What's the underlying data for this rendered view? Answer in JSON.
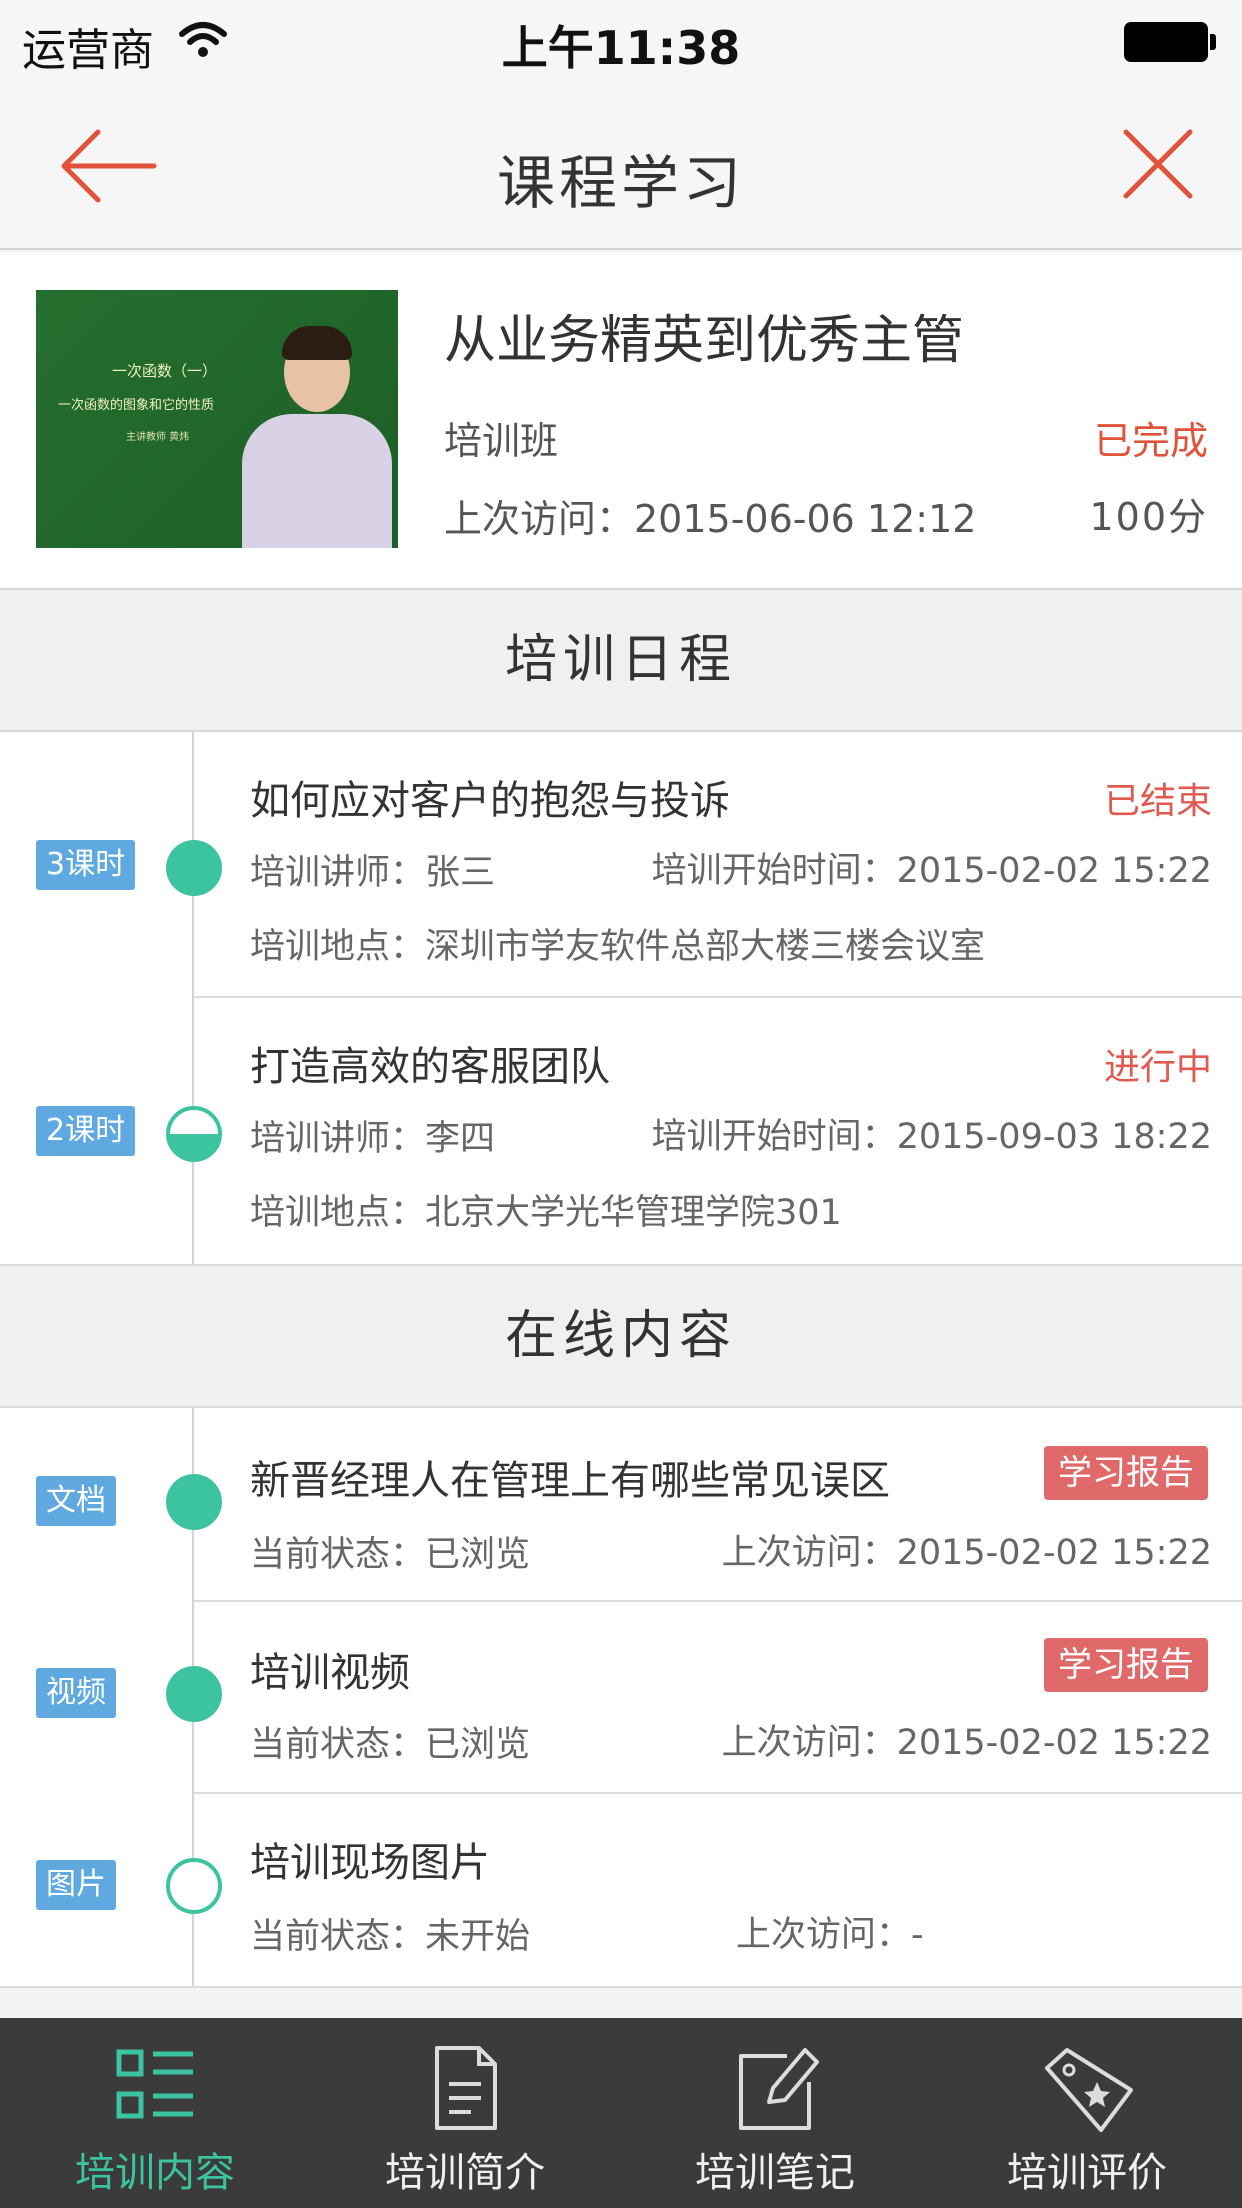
{
  "status_bar": {
    "carrier": "运营商",
    "time": "上午11:38"
  },
  "nav": {
    "title": "课程学习",
    "back_icon": "arrow-left-icon",
    "close_icon": "close-icon",
    "accent_color": "#e0533a"
  },
  "course": {
    "title": "从业务精英到优秀主管",
    "type": "培训班",
    "status": "已完成",
    "last_visit": "上次访问：2015-06-06 12:12",
    "score": "100分",
    "thumbnail": {
      "line1": "一次函数（一）",
      "line2": "一次函数的图象和它的性质",
      "line3": "主讲教师  黄炜"
    }
  },
  "schedule": {
    "header": "培训日程",
    "items": [
      {
        "tag": "3课时",
        "status_icon": "filled-dot",
        "title": "如何应对客户的抱怨与投诉",
        "state": "已结束",
        "lecturer": "培训讲师：张三",
        "start": "培训开始时间：2015-02-02 15:22",
        "location": "培训地点：深圳市学友软件总部大楼三楼会议室"
      },
      {
        "tag": "2课时",
        "status_icon": "half-filled-dot",
        "title": "打造高效的客服团队",
        "state": "进行中",
        "lecturer": "培训讲师：李四",
        "start": "培训开始时间：2015-09-03 18:22",
        "location": "培训地点：北京大学光华管理学院301"
      }
    ]
  },
  "online": {
    "header": "在线内容",
    "items": [
      {
        "tag": "文档",
        "status_icon": "filled-dot",
        "title": "新晋经理人在管理上有哪些常见误区",
        "badge": "学习报告",
        "state": "当前状态：已浏览",
        "visit": "上次访问：2015-02-02 15:22"
      },
      {
        "tag": "视频",
        "status_icon": "filled-dot",
        "title": "培训视频",
        "badge": "学习报告",
        "state": "当前状态：已浏览",
        "visit": "上次访问：2015-02-02 15:22"
      },
      {
        "tag": "图片",
        "status_icon": "empty-dot",
        "title": "培训现场图片",
        "badge": "",
        "state": "当前状态：未开始",
        "visit": "上次访问：-"
      }
    ]
  },
  "tabbar": {
    "active_color": "#3cc39f",
    "tabs": [
      {
        "label": "培训内容",
        "icon": "list-icon",
        "active": true
      },
      {
        "label": "培训简介",
        "icon": "document-icon",
        "active": false
      },
      {
        "label": "培训笔记",
        "icon": "edit-note-icon",
        "active": false
      },
      {
        "label": "培训评价",
        "icon": "tag-star-icon",
        "active": false
      }
    ]
  }
}
